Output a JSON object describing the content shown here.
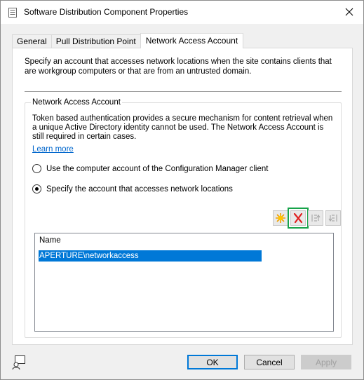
{
  "window": {
    "title": "Software Distribution Component Properties"
  },
  "tabs": [
    {
      "label": "General",
      "active": false
    },
    {
      "label": "Pull Distribution Point",
      "active": false
    },
    {
      "label": "Network Access Account",
      "active": true
    }
  ],
  "panel": {
    "intro": "Specify an account that accesses network locations when the site contains clients that are workgroup computers or that are from an untrusted domain.",
    "group": {
      "legend": "Network Access Account",
      "description": "Token based authentication provides a secure mechanism for content retrieval when a unique Active Directory identity cannot be used. The Network Access Account is still required in certain cases.",
      "learn_more": "Learn more",
      "options": [
        {
          "label": "Use the computer account of the Configuration Manager client",
          "checked": false
        },
        {
          "label": "Specify the account that accesses network locations",
          "checked": true
        }
      ],
      "toolbar": {
        "new_icon": "star-new-icon",
        "delete_icon": "red-x-delete-icon",
        "move_up_icon": "move-up-icon",
        "move_down_icon": "move-down-icon",
        "highlight_color": "#17a34a"
      },
      "list": {
        "column_name": "Name",
        "rows": [
          {
            "name": "APERTURE\\networkaccess",
            "selected": true
          }
        ]
      }
    }
  },
  "buttons": {
    "ok": "OK",
    "cancel": "Cancel",
    "apply": "Apply"
  },
  "colors": {
    "selection": "#0078d7",
    "link": "#0066cc"
  }
}
